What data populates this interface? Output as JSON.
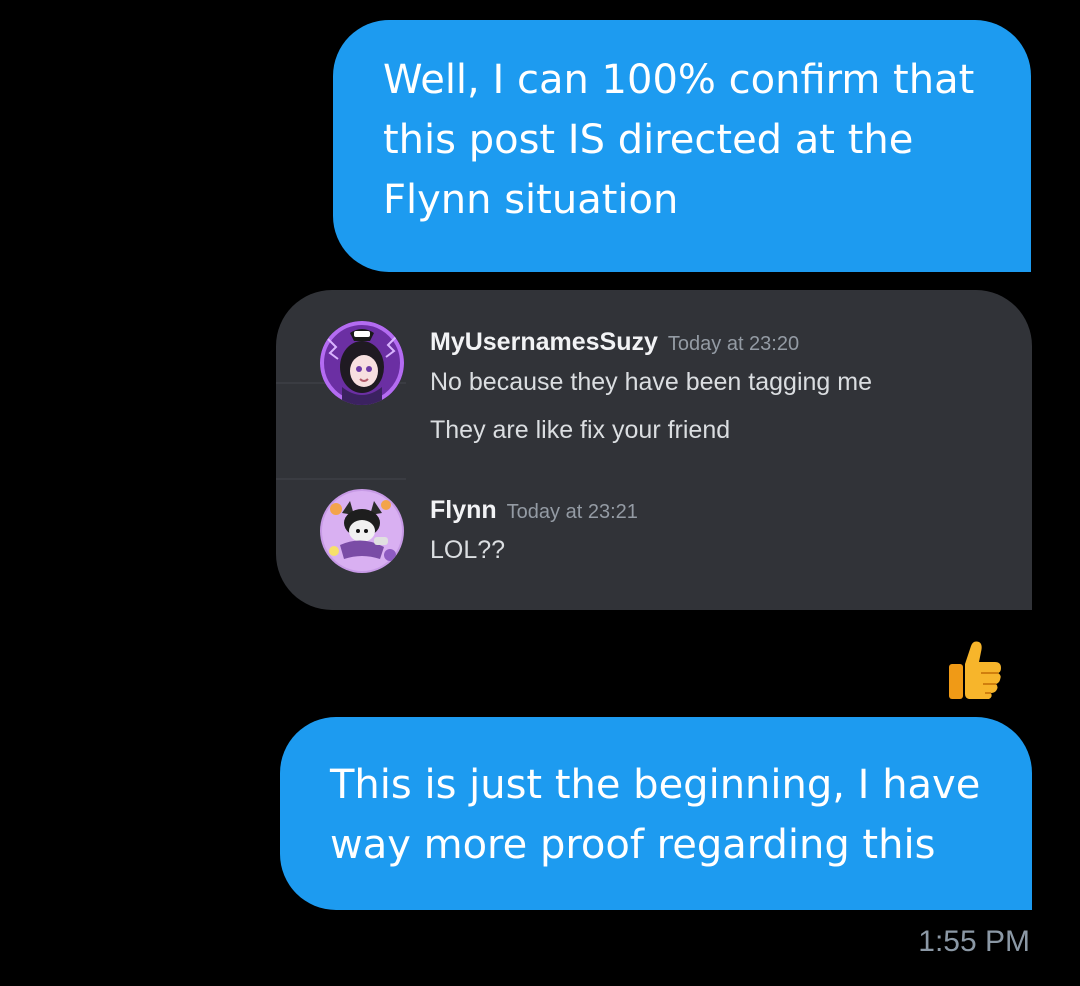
{
  "conversation": {
    "messages": [
      {
        "lines": [
          "Well, I can 100% confirm that",
          "this post IS directed at the",
          "Flynn situation"
        ]
      },
      {
        "lines": [
          "This is just the beginning, I have",
          "way more proof regarding this"
        ]
      }
    ],
    "embed": {
      "posts": [
        {
          "username": "MyUsernamesSuzy",
          "timestamp": "Today at 23:20",
          "lines": [
            "No because they have been tagging me",
            "They are like fix your friend"
          ]
        },
        {
          "username": "Flynn",
          "timestamp": "Today at 23:21",
          "lines": [
            "LOL??"
          ]
        }
      ]
    },
    "reaction": {
      "icon": "thumbs-up-icon"
    },
    "sent_time": "1:55 PM"
  },
  "colors": {
    "background": "#000000",
    "bubble": "#1d9bf0",
    "embed_background": "#313338",
    "username": "#f2f3f5",
    "timestamp": "#949ba4",
    "embed_text": "#dbdee1",
    "time_text": "#8b98a5"
  }
}
